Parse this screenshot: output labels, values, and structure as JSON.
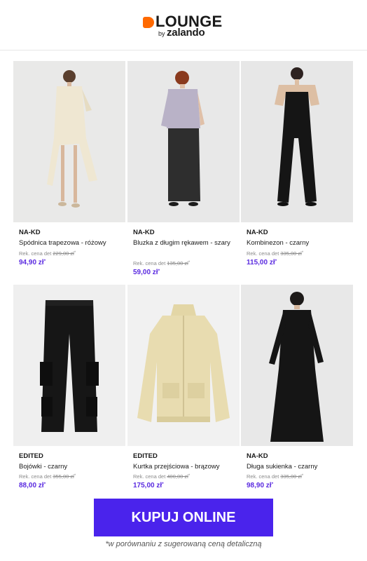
{
  "header": {
    "logo_word": "LOUNGE",
    "logo_by": "by",
    "logo_brand": "zalando",
    "accent_color": "#ff6900"
  },
  "products": [
    {
      "brand": "NA-KD",
      "name": "Spódnica trapezowa - różowy",
      "ref_label": "Rek. cena det",
      "ref_price": "229,00 zł",
      "price": "94,90 zł",
      "image_icon": "model-cream-dress-image"
    },
    {
      "brand": "NA-KD",
      "name": "Bluzka z długim rękawem - szary",
      "ref_label": "Rek. cena det",
      "ref_price": "135,00 zł",
      "price": "59,00 zł",
      "image_icon": "model-grey-blouse-image"
    },
    {
      "brand": "NA-KD",
      "name": "Kombinezon - czarny",
      "ref_label": "Rek. cena det",
      "ref_price": "335,00 zł",
      "price": "115,00 zł",
      "image_icon": "model-black-jumpsuit-image"
    },
    {
      "brand": "EDITED",
      "name": "Bojówki - czarny",
      "ref_label": "Rek. cena det",
      "ref_price": "355,00 zł",
      "price": "88,00 zł",
      "image_icon": "black-cargo-pants-image"
    },
    {
      "brand": "EDITED",
      "name": "Kurtka przejściowa - brązowy",
      "ref_label": "Rek. cena det",
      "ref_price": "400,00 zł",
      "price": "175,00 zł",
      "image_icon": "beige-jacket-image"
    },
    {
      "brand": "NA-KD",
      "name": "Długa sukienka - czarny",
      "ref_label": "Rek. cena det",
      "ref_price": "335,00 zł",
      "price": "98,90 zł",
      "image_icon": "model-black-dress-image"
    }
  ],
  "asterisk": "*",
  "cta": {
    "label": "KUPUJ ONLINE",
    "color": "#4a23ec"
  },
  "footnote": "*w porównaniu z sugerowaną ceną detaliczną",
  "price_color": "#5a2ae0"
}
